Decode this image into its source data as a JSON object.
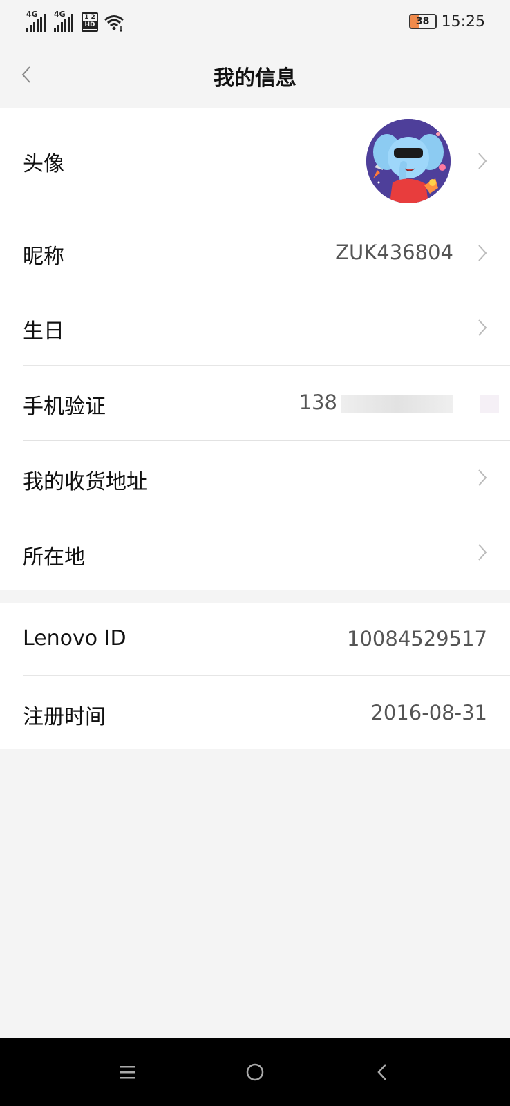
{
  "status_bar": {
    "signal_1_label": "4G",
    "signal_2_label": "4G",
    "sim_label_top": "1 2",
    "sim_label_bottom": "HD",
    "battery_level": "38",
    "battery_fraction": 0.38,
    "time": "15:25",
    "icons": [
      "signal-icon",
      "signal-icon",
      "sim-hd-icon",
      "wifi-icon",
      "battery-icon"
    ]
  },
  "header": {
    "title": "我的信息",
    "back_icon": "chevron-left-icon"
  },
  "profile": {
    "avatar_label": "头像",
    "nickname_label": "昵称",
    "nickname_value": "ZUK436804",
    "birthday_label": "生日",
    "phone_label": "手机验证",
    "phone_value_visible": "138",
    "address_label": "我的收货地址",
    "location_label": "所在地"
  },
  "account": {
    "lenovo_id_label": "Lenovo ID",
    "lenovo_id_value": "10084529517",
    "register_label": "注册时间",
    "register_value": "2016-08-31"
  },
  "nav_bar": {
    "icons": [
      "menu-icon",
      "home-circle-icon",
      "back-triangle-icon"
    ]
  },
  "colors": {
    "background": "#f4f4f4",
    "card": "#ffffff",
    "text_primary": "#111111",
    "text_secondary": "#555555",
    "divider": "#e6e6e6",
    "battery_fill": "#f08a4b",
    "avatar_bg": "#4e3f9a"
  }
}
